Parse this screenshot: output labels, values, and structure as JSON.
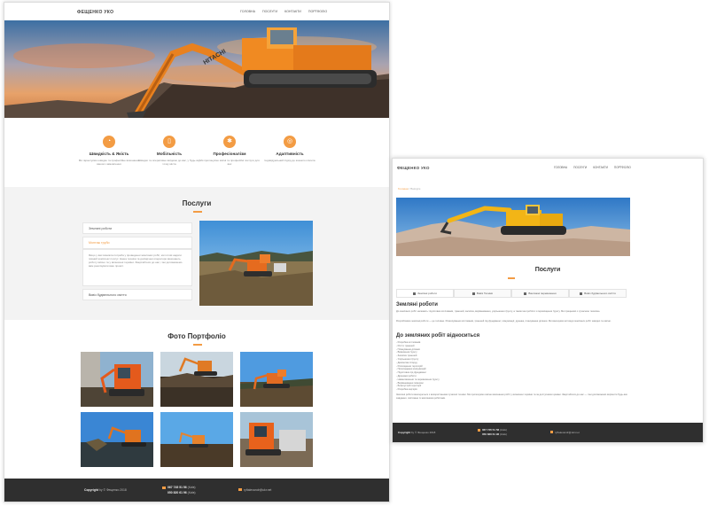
{
  "site": {
    "logo": "ФЕЩЕНКО УКО",
    "nav": [
      "Головна",
      "Послуги",
      "Контакти",
      "Портфоліо"
    ]
  },
  "features": [
    {
      "icon": "speedometer-icon",
      "title": "Швидкість & Якість",
      "text": "Ми гарантуємо швидке та професійне виконання вашого замовлення"
    },
    {
      "icon": "mobile-phone-icon",
      "title": "Мобільність",
      "text": "Швидко та оперативно виїдемо до вас, у будь-яку точку міста"
    },
    {
      "icon": "gear-icon",
      "title": "Професіоналізм",
      "text": "Ми пропонуємо якісні та професійні послуги для вас"
    },
    {
      "icon": "target-icon",
      "title": "Адаптивність",
      "text": "Індивідуальний підхід до кожного клієнта"
    }
  ],
  "services": {
    "title": "Послуги",
    "items": [
      "Земляні роботи",
      "Монтаж труби",
      "Вивіз будівельного сміття"
    ],
    "expanded_text": "Якщо у вас виникла потреба у проведенні земляних робіт, ми готові надати повний комплекс послуг. Наша техніка та досвідчені оператори виконають роботу якісно та у визначені терміни. Звертайтеся до нас, і ми допоможемо вам реалізувати ваш проєкт."
  },
  "portfolio": {
    "title": "Фото Портфоліо"
  },
  "footer": {
    "copyright_label": "Copyright",
    "copyright_by": "by",
    "copyright_text": "© Фещенко 2018",
    "phone1": "067 745 51 56",
    "phone1_note": "(Київ)",
    "phone2": "050 820 61 96",
    "phone2_note": "(Київ)",
    "email": "ryftalexandr@ukr.net"
  },
  "services_page": {
    "breadcrumb_home": "Головна",
    "breadcrumb_sep": "/",
    "breadcrumb_current": "Послуги",
    "title": "Послуги",
    "tabs": [
      "Земляні роботи",
      "Вивіз Техніки",
      "Вантажні перевезення",
      "Вивіз будівельного сміття"
    ],
    "heading1": "Земляні роботи",
    "para1": "До земляних робіт належать: підготовка котлованів, траншей, засипка, вирівнювання, ущільнення ґрунту, а також інші роботи з переміщення ґрунту. Ми працюємо з сучасною технікою.",
    "para2": "Розробляємо земляні роботи — це головне. Розкопування котлованів, траншей під фундамент, комунікації, дренаж, планування ділянки. Ми виконуємо всі види земляних робіт швидко та якісно.",
    "heading2": "До земляних робіт відноситься",
    "list": [
      "Розробка котлованів",
      "Риття траншей",
      "Планування ділянки",
      "Вивезення ґрунту",
      "Засипка траншей",
      "Ущільнення ґрунту",
      "Демонтаж споруд",
      "Розчищення територій",
      "Прокладання комунікацій",
      "Підготовка під фундамент",
      "Дренажні роботи",
      "Навантаження та перевезення ґрунту",
      "Вирівнювання поверхні",
      "Благоустрій території",
      "Розробка кар'єрів"
    ],
    "para3": "Земляні роботи виконуються з використанням сучасної техніки. Ми пропонуємо якісне виконання робіт у визначені терміни та за доступними цінами. Звертайтеся до нас — і ми допоможемо вирішити будь-яке завдання, пов'язане із земляними роботами."
  }
}
